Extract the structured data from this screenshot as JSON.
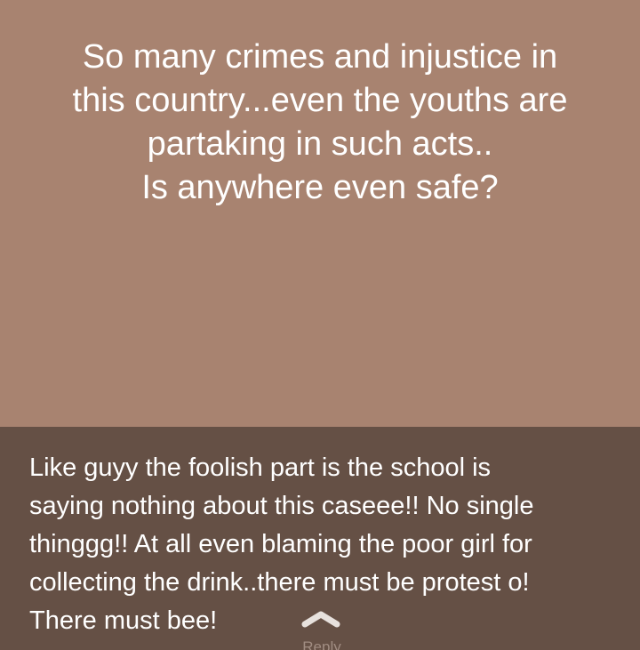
{
  "status": {
    "background_color": "#a88370",
    "text_color": "#ffffff",
    "lines": [
      "So many crimes and injustice in",
      "this country...even the youths are",
      "partaking in such acts..",
      "Is anywhere even safe?"
    ]
  },
  "reply_overlay": {
    "background_color": "#655045",
    "text_color": "#ffffff",
    "message_lines": [
      "Like guyy the foolish part is the school is",
      "saying nothing about this caseee!! No single",
      "thinggg!! At all even blaming the poor girl for",
      "collecting the drink..there must be protest o!",
      "There must bee!"
    ],
    "reply_icon": "chevron-up-icon",
    "reply_label": "Reply"
  }
}
